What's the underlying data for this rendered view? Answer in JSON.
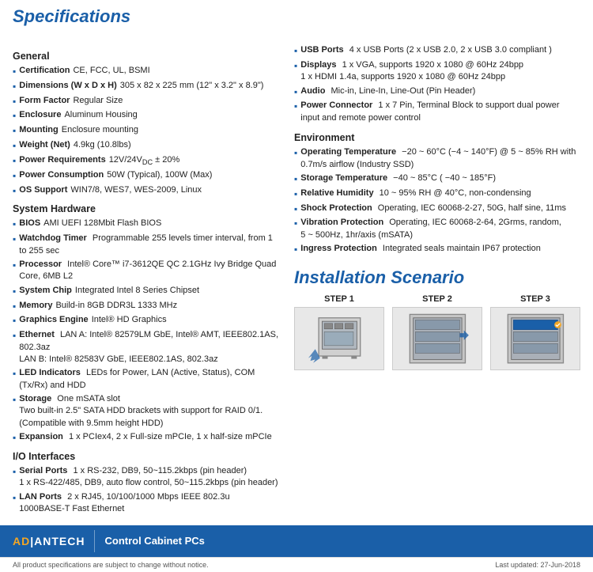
{
  "page": {
    "title": "Specifications",
    "install_title": "Installation Scenario",
    "footer_brand": "AD|ANTECH",
    "footer_product": "Control Cabinet PCs",
    "footer_note": "All product specifications are subject to change without notice.",
    "footer_date": "Last updated: 27-Jun-2018"
  },
  "general": {
    "section": "General",
    "items": [
      {
        "label": "Certification",
        "value": "CE, FCC, UL, BSMI"
      },
      {
        "label": "Dimensions (W x D x H)",
        "value": "305 x 82 x 225 mm (12\" x 3.2\" x 8.9\")"
      },
      {
        "label": "Form Factor",
        "value": "Regular Size"
      },
      {
        "label": "Enclosure",
        "value": "Aluminum Housing"
      },
      {
        "label": "Mounting",
        "value": "Enclosure mounting"
      },
      {
        "label": "Weight (Net)",
        "value": "4.9kg (10.8lbs)"
      },
      {
        "label": "Power Requirements",
        "value": "12V/24VDC ± 20%"
      },
      {
        "label": "Power Consumption",
        "value": "50W (Typical), 100W (Max)"
      },
      {
        "label": "OS Support",
        "value": "WIN7/8, WES7, WES-2009, Linux"
      }
    ]
  },
  "system_hardware": {
    "section": "System Hardware",
    "items": [
      {
        "label": "BIOS",
        "value": "AMI UEFI 128Mbit Flash BIOS"
      },
      {
        "label": "Watchdog Timer",
        "value": "Programmable 255 levels timer interval, from 1 to 255 sec"
      },
      {
        "label": "Processor",
        "value": "Intel® Core™ i7-3612QE QC 2.1GHz Ivy Bridge Quad Core, 6MB L2"
      },
      {
        "label": "System Chip",
        "value": "Integrated Intel 8 Series Chipset"
      },
      {
        "label": "Memory",
        "value": "Build-in 8GB DDR3L 1333 MHz"
      },
      {
        "label": "Graphics Engine",
        "value": "Intel® HD Graphics"
      },
      {
        "label": "Ethernet",
        "value": "LAN A: Intel® 82579LM GbE, Intel® AMT, IEEE802.1AS, 802.3az\nLAN B: Intel® 82583V GbE, IEEE802.1AS, 802.3az"
      },
      {
        "label": "LED Indicators",
        "value": "LEDs for Power, LAN (Active, Status), COM (Tx/Rx) and HDD"
      },
      {
        "label": "Storage",
        "value": "One mSATA slot\nTwo built-in 2.5\" SATA HDD brackets with support for RAID 0/1. (Compatible with 9.5mm height HDD)"
      },
      {
        "label": "Expansion",
        "value": "1 x PCIex4, 2 x Full-size mPCIe, 1 x half-size mPCIe"
      }
    ]
  },
  "io_interfaces": {
    "section": "I/O Interfaces",
    "items": [
      {
        "label": "Serial Ports",
        "value": "1 x RS-232, DB9, 50~115.2kbps (pin header)\n1 x RS-422/485, DB9, auto flow control, 50~115.2kbps (pin header)"
      },
      {
        "label": "LAN Ports",
        "value": "2 x RJ45, 10/100/1000 Mbps IEEE 802.3u\n1000BASE-T Fast Ethernet"
      }
    ]
  },
  "io_right": {
    "items": [
      {
        "label": "USB Ports",
        "value": "4 x USB Ports (2 x USB 2.0, 2 x USB 3.0 compliant )"
      },
      {
        "label": "Displays",
        "value": "1 x VGA, supports 1920 x 1080 @ 60Hz 24bpp\n1 x HDMI 1.4a, supports 1920 x 1080 @ 60Hz 24bpp"
      },
      {
        "label": "Audio",
        "value": "Mic-in, Line-In, Line-Out (Pin Header)"
      },
      {
        "label": "Power Connector",
        "value": "1 x 7 Pin, Terminal Block to support dual power input and remote power control"
      }
    ]
  },
  "environment": {
    "section": "Environment",
    "items": [
      {
        "label": "Operating Temperature",
        "value": "−20 ~ 60°C (−4 ~ 140°F) @ 5 ~ 85% RH with 0.7m/s airflow (Industry SSD)"
      },
      {
        "label": "Storage Temperature",
        "value": "−40 ~ 85°C ( −40 ~ 185°F)"
      },
      {
        "label": "Relative Humidity",
        "value": "10 ~ 95% RH @ 40°C, non-condensing"
      },
      {
        "label": "Shock Protection",
        "value": "Operating, IEC 60068-2-27, 50G, half sine, 11ms"
      },
      {
        "label": "Vibration Protection",
        "value": "Operating, IEC 60068-2-64, 2Grms, random,\n5 ~ 500Hz, 1hr/axis (mSATA)"
      },
      {
        "label": "Ingress Protection",
        "value": "Integrated seals maintain IP67 protection"
      }
    ]
  },
  "steps": [
    {
      "label": "STEP 1"
    },
    {
      "label": "STEP 2"
    },
    {
      "label": "STEP 3"
    }
  ]
}
